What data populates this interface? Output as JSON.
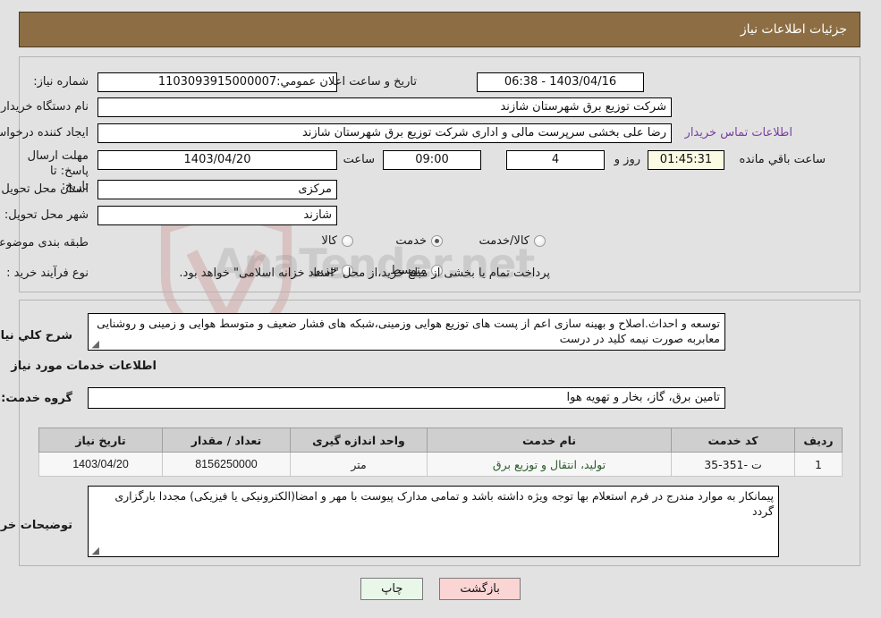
{
  "header": {
    "title": "جزئیات اطلاعات نیاز"
  },
  "form": {
    "need_number_label": "شماره نیاز:",
    "need_number_value": "1103093915000007",
    "announce_label": "تاریخ و ساعت اعلان عمومي:",
    "announce_value": "1403/04/16 - 06:38",
    "buyer_org_label": "نام دستگاه خریدار:",
    "buyer_org_value": "شرکت توزیع برق شهرستان شازند",
    "creator_label": "ایجاد کننده درخواست:",
    "creator_value": "رضا علی بخشی سرپرست مالی و اداری شرکت توزیع برق شهرستان شازند",
    "contact_link": "اطلاعات تماس خریدار",
    "deadline_label": "مهلت ارسال پاسخ: تا تاریخ:",
    "deadline_date": "1403/04/20",
    "hour_label": "ساعت",
    "hour_value": "09:00",
    "days_value": "4",
    "days_suffix": "روز و",
    "timer_value": "01:45:31",
    "timer_suffix": "ساعت باقي مانده",
    "province_label": "استان محل تحویل:",
    "province_value": "مرکزی",
    "city_label": "شهر محل تحویل:",
    "city_value": "شازند",
    "category_label": "طبقه بندی موضوعی:",
    "category_options": [
      {
        "label": "کالا",
        "selected": false
      },
      {
        "label": "خدمت",
        "selected": true
      },
      {
        "label": "کالا/خدمت",
        "selected": false
      }
    ],
    "process_label": "نوع فرآیند خرید :",
    "process_options": [
      {
        "label": "جزیي",
        "selected": false
      },
      {
        "label": "متوسط",
        "selected": false
      }
    ],
    "payment_note": "پرداخت تمام یا بخشی از مبلغ خرید،از محل \"اسناد خزانه اسلامی\" خواهد بود."
  },
  "detail": {
    "general_label": "شرح کلي نیاز:",
    "general_value": "توسعه و احداث.اصلاح و بهینه سازی اعم از پست های توزیع هوایی وزمینی،شبکه های فشار ضعیف و متوسط هوایی و زمینی و روشنایی معابربه صورت نیمه کلید در درست",
    "services_heading": "اطلاعات خدمات مورد نیاز",
    "service_group_label": "گروه خدمت:",
    "service_group_value": "تامین برق، گاز، بخار و تهویه هوا",
    "table": {
      "headers": [
        "ردیف",
        "کد خدمت",
        "نام خدمت",
        "واحد اندازه گیری",
        "تعداد / مقدار",
        "تاریخ نیاز"
      ],
      "rows": [
        {
          "index": "1",
          "code": "ت -351-35",
          "name": "تولید، انتقال و توزیع برق",
          "unit": "متر",
          "quantity": "8156250000",
          "date": "1403/04/20"
        }
      ]
    },
    "buyer_notes_label": "توضیحات خریدار:",
    "buyer_notes_value": "پیمانکار به موارد مندرج در فرم استعلام بها توجه ویژه داشته باشد و تمامی مدارک پیوست با مهر و امضا(الکترونیکی یا فیزیکی) مجددا بارگزاری گردد"
  },
  "footer": {
    "print_label": "چاپ",
    "back_label": "بازگشت"
  },
  "watermark": {
    "text_left": "AnaTender",
    "text_right": ".net"
  },
  "colors": {
    "header_bg": "#8d6e44",
    "page_bg": "#e2e2e2",
    "link": "#7b3fa0",
    "timer_bg": "#fbfbe3",
    "print_btn_bg": "#e9f7e9",
    "back_btn_bg": "#fbd4d4",
    "table_header_bg": "#cfcfcf"
  }
}
